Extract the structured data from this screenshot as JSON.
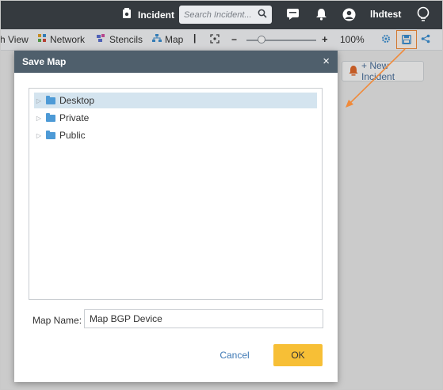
{
  "header": {
    "incident_label": "Incident",
    "search_placeholder": "Search Incident...",
    "username": "lhdtest"
  },
  "toolbar": {
    "view_label": "h View",
    "network_label": "Network",
    "stencils_label": "Stencils",
    "map_label": "Map",
    "separator": "|",
    "zoom_minus": "−",
    "zoom_plus": "+",
    "zoom_level": "100%"
  },
  "canvas": {
    "new_incident_label": "+ New Incident"
  },
  "dialog": {
    "title": "Save Map",
    "close": "×",
    "tree": [
      {
        "label": "Desktop",
        "selected": true
      },
      {
        "label": "Private",
        "selected": false
      },
      {
        "label": "Public",
        "selected": false
      }
    ],
    "map_name_label": "Map Name:",
    "map_name_value": "Map BGP Device",
    "cancel_label": "Cancel",
    "ok_label": "OK"
  },
  "colors": {
    "header_bg": "#353a3f",
    "dialog_header_bg": "#4f5f6c",
    "ok_button": "#f7bf36",
    "highlight_orange": "#f08a3a",
    "tree_selected": "#d4e4ef",
    "folder": "#4d9ad6"
  }
}
